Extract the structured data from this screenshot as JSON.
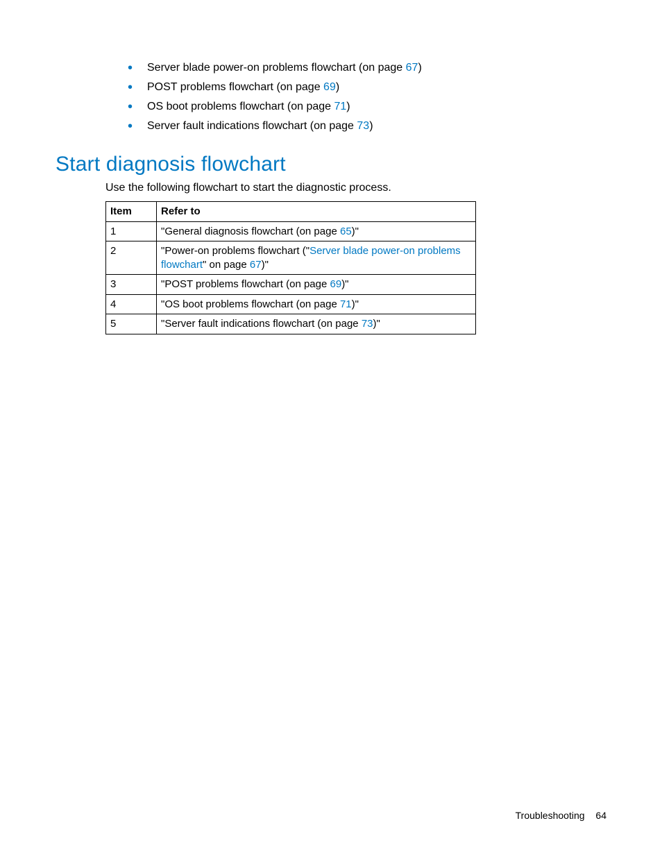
{
  "bullets": [
    {
      "prefix": "Server blade power-on problems flowchart (on page ",
      "link": "67",
      "suffix": ")"
    },
    {
      "prefix": "POST problems flowchart (on page ",
      "link": "69",
      "suffix": ")"
    },
    {
      "prefix": "OS boot problems flowchart (on page ",
      "link": "71",
      "suffix": ")"
    },
    {
      "prefix": "Server fault indications flowchart (on page ",
      "link": "73",
      "suffix": ")"
    }
  ],
  "heading": "Start diagnosis flowchart",
  "intro": "Use the following flowchart to start the diagnostic process.",
  "table": {
    "headers": {
      "item": "Item",
      "refer": "Refer to"
    },
    "rows": [
      {
        "item": "1",
        "segments": [
          {
            "text": "\"General diagnosis flowchart (on page "
          },
          {
            "text": "65",
            "link": true
          },
          {
            "text": ")\""
          }
        ]
      },
      {
        "item": "2",
        "segments": [
          {
            "text": "\"Power-on problems flowchart (\""
          },
          {
            "text": "Server blade power-on problems flowchart",
            "link": true
          },
          {
            "text": "\" on page "
          },
          {
            "text": "67",
            "link": true
          },
          {
            "text": ")\""
          }
        ]
      },
      {
        "item": "3",
        "segments": [
          {
            "text": "\"POST problems flowchart (on page "
          },
          {
            "text": "69",
            "link": true
          },
          {
            "text": ")\""
          }
        ]
      },
      {
        "item": "4",
        "segments": [
          {
            "text": "\"OS boot problems flowchart (on page "
          },
          {
            "text": "71",
            "link": true
          },
          {
            "text": ")\""
          }
        ]
      },
      {
        "item": "5",
        "segments": [
          {
            "text": "\"Server fault indications flowchart (on page "
          },
          {
            "text": "73",
            "link": true
          },
          {
            "text": ")\""
          }
        ]
      }
    ]
  },
  "footer": {
    "section": "Troubleshooting",
    "page": "64"
  }
}
